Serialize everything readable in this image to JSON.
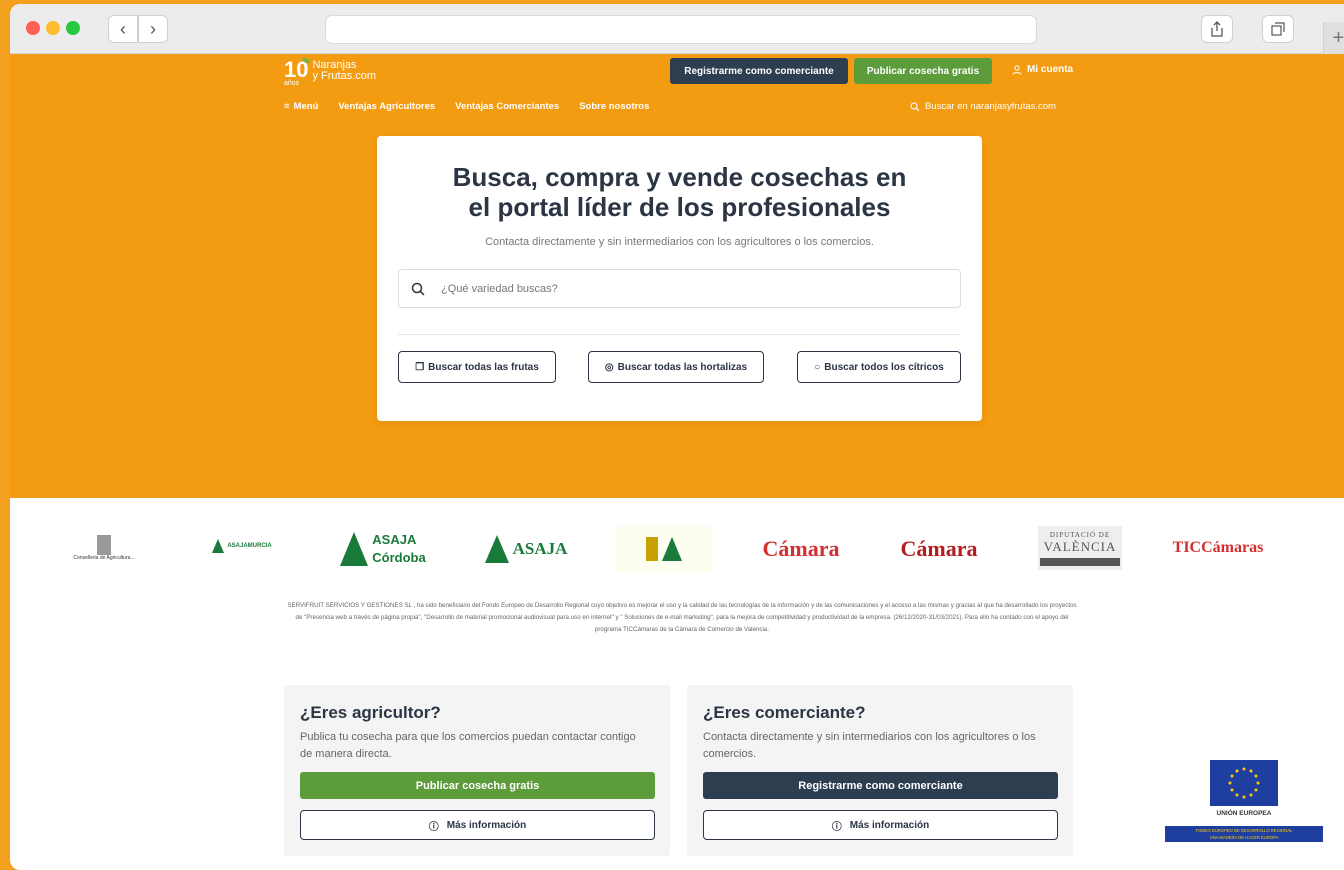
{
  "site": {
    "logo_number": "10",
    "logo_years": "años",
    "logo_line1": "Naranjas",
    "logo_line2": "y Frutas.com",
    "header_register": "Registrarme como comerciante",
    "header_publish": "Publicar cosecha gratis",
    "header_account": "Mi cuenta",
    "nav": {
      "menu": "Menú",
      "items": [
        "Ventajas Agricultores",
        "Ventajas Comerciantes",
        "Sobre nosotros"
      ],
      "search": "Buscar en naranjasyfrutas.com"
    }
  },
  "hero": {
    "title_line1": "Busca, compra y vende cosechas en",
    "title_line2": "el portal líder de los profesionales",
    "subtitle": "Contacta directamente y sin intermediarios con los agricultores o los comercios.",
    "search_placeholder": "¿Qué variedad buscas?",
    "categories": [
      "Buscar todas las frutas",
      "Buscar todas las hortalizas",
      "Buscar todos los cítricos"
    ]
  },
  "logos": {
    "gva": "Conselleria de Agricultura...",
    "asaja_murcia": "ASAJAMURCIA",
    "asaja_cordoba_1": "ASAJA",
    "asaja_cordoba_2": "Córdoba",
    "asaja_malaga": "ASAJA",
    "camara_espana": "Cámara",
    "camara_valencia": "Cámara",
    "diputacio_1": "DIPUTACIÓ DE",
    "diputacio_2": "VALÈNCIA",
    "tic": "TICCámaras"
  },
  "disclaimer": "SERVIFRUIT SERVICIOS Y GESTIONES SL , ha sido beneficiario del Fondo Europeo de Desarrollo Regional cuyo objetivo es mejorar el uso y la calidad de las tecnologías de la información y de las comunicaciones y el acceso a las mismas y gracias al que ha desarrollado los proyectos de \"Presencia web a través de página propia\", \"Desarrollo de material promocional audiovisual para uso en internet\" y \" Soluciones de e-mail marketing\", para la mejora de competitividad y productividad de la empresa. (26/12/2020-31/03/2021). Para ello ha contado con el apoyo del programa TICCámaras de la Cámara de Comercio de Valencia.",
  "farmer": {
    "title": "¿Eres agricultor?",
    "text": "Publica tu cosecha para que los comercios puedan contactar contigo de manera directa.",
    "primary": "Publicar cosecha gratis",
    "secondary": "Más información"
  },
  "merchant": {
    "title": "¿Eres comerciante?",
    "text": "Contacta directamente y sin intermediarios con los agricultores o los comercios.",
    "primary": "Registrarme como comerciante",
    "secondary": "Más información"
  },
  "eu": {
    "label": "UNIÓN EUROPEA",
    "strip_line1": "FONDO EUROPEO DE DESARROLLO REGIONAL",
    "strip_line2": "UNA MANERA DE HACER EUROPA"
  },
  "colors": {
    "orange": "#f39c12",
    "navy": "#2c3e50",
    "green": "#5d9c3b"
  }
}
